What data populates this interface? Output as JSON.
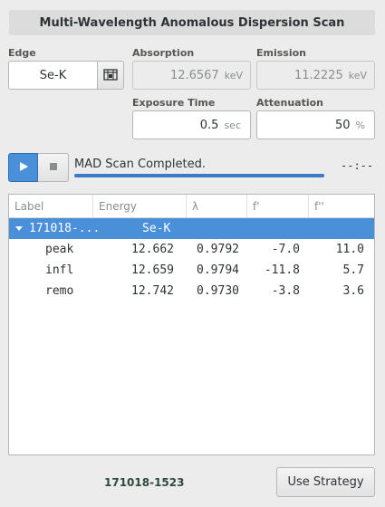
{
  "title": "Multi-Wavelength Anomalous Dispersion Scan",
  "edge": {
    "label": "Edge",
    "value": "Se-K",
    "button_icon": "periodic-table-icon"
  },
  "absorption": {
    "label": "Absorption",
    "value": "12.6567",
    "unit": "keV"
  },
  "emission": {
    "label": "Emission",
    "value": "11.2225",
    "unit": "keV"
  },
  "exposure": {
    "label": "Exposure Time",
    "value": "0.5",
    "unit": "sec"
  },
  "attenuation": {
    "label": "Attenuation",
    "value": "50",
    "unit": "%"
  },
  "scan": {
    "status": "MAD Scan Completed.",
    "progress": 1.0,
    "time_remaining": "--:--"
  },
  "table": {
    "headers": [
      "Label",
      "Energy",
      "λ",
      "f'",
      "f''"
    ],
    "group": {
      "name": "171018-...",
      "edge": "Se-K"
    },
    "rows": [
      {
        "label": "peak",
        "energy": "12.662",
        "wavelength": "0.9792",
        "fp": "-7.0",
        "fpp": "11.0"
      },
      {
        "label": "infl",
        "energy": "12.659",
        "wavelength": "0.9794",
        "fp": "-11.8",
        "fpp": "5.7"
      },
      {
        "label": "remo",
        "energy": "12.742",
        "wavelength": "0.9730",
        "fp": "-3.8",
        "fpp": "3.6"
      }
    ]
  },
  "footer": {
    "session": "171018-1523",
    "strategy_button": "Use Strategy"
  },
  "colors": {
    "accent": "#4a90d9",
    "progress": "#3b7bc6"
  }
}
